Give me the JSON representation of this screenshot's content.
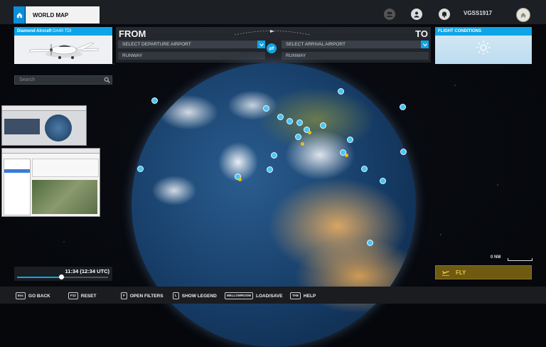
{
  "top_bar": {
    "tab_title": "WORLD MAP",
    "username": "VGSS1917"
  },
  "aircraft": {
    "brand": "Diamond Aircraft",
    "model": "DA40 TDI"
  },
  "route": {
    "from_label": "FROM",
    "to_label": "TO",
    "departure_placeholder": "SELECT DEPARTURE AIRPORT",
    "arrival_placeholder": "SELECT ARRIVAL AIRPORT",
    "departure_runway": "RUNWAY",
    "arrival_runway": "RUNWAY"
  },
  "conditions": {
    "title": "FLIGHT CONDITIONS",
    "weather_icon": "sun-icon"
  },
  "search": {
    "placeholder": "Search"
  },
  "map": {
    "scale_label": "0 NM"
  },
  "time": {
    "label": "11:34 (12:34 UTC)",
    "slider_fraction": 0.49
  },
  "fly": {
    "label": "FLY"
  },
  "bottom_hints": [
    {
      "key": "Esc",
      "label": "GO BACK"
    },
    {
      "key": "F12",
      "label": "RESET"
    },
    {
      "key": "F",
      "label": "OPEN FILTERS"
    },
    {
      "key": "L",
      "label": "SHOW LEGEND"
    },
    {
      "key": "MELLOWROOM",
      "label": "LOAD/SAVE"
    },
    {
      "key": "TAB",
      "label": "HELP"
    }
  ],
  "colors": {
    "accent": "#0ea5e8",
    "fly": "#6f5a12"
  }
}
